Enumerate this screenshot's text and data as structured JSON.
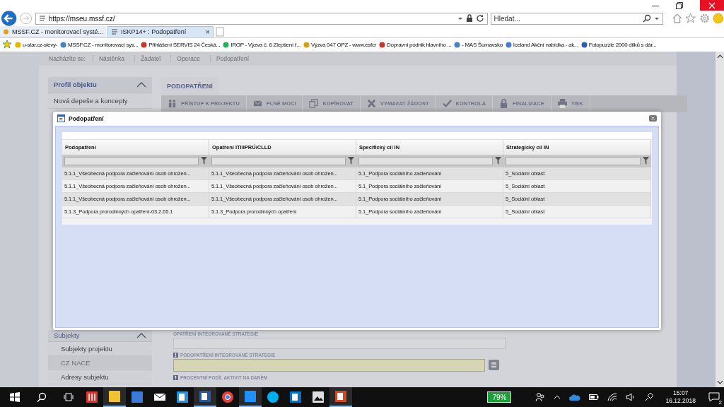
{
  "browser": {
    "url": "https://mseu.mssf.cz/",
    "search_placeholder": "Hledat...",
    "tabs": [
      {
        "label": "MSSF.CZ - monitorovací systé...",
        "selected": false
      },
      {
        "label": "ISKP14+ : Podopatření",
        "selected": true,
        "close": "×"
      }
    ],
    "favorites": [
      "u-star.cz-slevy-",
      "MSSF.CZ - monitorovací sys...",
      "Přihlášení SERVIS 24  Česká...",
      "IROP - Výzva č. 6 Zlepšení ř...",
      "Výzva 047 OPZ - www.esfcr",
      "Dopravní podnik hlavního ...",
      "- MAS Šumavsko",
      "Iceland  Akční nabídka - ak...",
      "Fotopuzzle 2000 dílků s dár..."
    ]
  },
  "breadcrumb": {
    "label": "Nacházíte se:",
    "items": [
      "Nástěnka",
      "Žadatel",
      "Operace",
      "Podopatření"
    ]
  },
  "sidebar": {
    "sections": [
      {
        "title": "Profil objektu",
        "expanded": true,
        "items": [
          {
            "label": "Nová depeše a koncepty",
            "disabled": false
          }
        ]
      },
      {
        "title": "Subjekty",
        "expanded": true,
        "items": [
          {
            "label": "Subjekty projektu",
            "disabled": false
          },
          {
            "label": "CZ NACE",
            "disabled": true
          },
          {
            "label": "Adresy subjektu",
            "disabled": false
          }
        ]
      }
    ]
  },
  "main": {
    "tab": "PODOPATŘENÍ",
    "toolbar": [
      "PŘÍSTUP K PROJEKTU",
      "PLNÉ MOCI",
      "KOPÍROVAT",
      "VYMAZAT ŽÁDOST",
      "KONTROLA",
      "FINALIZACE",
      "TISK"
    ],
    "fields": [
      {
        "label": "OPATŘENÍ INTEGROVANÉ STRATEGIE",
        "required": false,
        "kind": "text"
      },
      {
        "label": "PODOPATŘENÍ INTEGROVANÉ STRATEGIE",
        "required": true,
        "kind": "lookup"
      },
      {
        "label": "PROCENTNÍ PODÍL AKTIVIT NA DANÉM",
        "required": true,
        "kind": "label"
      }
    ]
  },
  "modal": {
    "title": "Podopatření",
    "columns": [
      "Podopatření",
      "Opatření ITI/IPRÚ/CLLD",
      "Specifický cíl IN",
      "Strategický cíl IN"
    ],
    "rows": [
      [
        "5.1.1_Všeobecná podpora začleňování osob ohrožen...",
        "5.1.1_Všeobecná podpora začleňování osob ohrožen...",
        "5.1_Podpora sociálního začleňování",
        "5_Sociální oblast"
      ],
      [
        "5.1.1_Všeobecná podpora začleňování osob ohrožen...",
        "5.1.1_Všeobecná podpora začleňování osob ohrožen...",
        "5.1_Podpora sociálního začleňování",
        "5_Sociální oblast"
      ],
      [
        "5.1.1_Všeobecná podpora začleňování osob ohrožen...",
        "5.1.1_Všeobecná podpora začleňování osob ohrožen...",
        "5.1_Podpora sociálního začleňování",
        "5_Sociální oblast"
      ],
      [
        "5.1.3_Podpora prorodinných opatření-03.2.65.1",
        "5.1.3_Podpora prorodinných opatření",
        "5.1_Podpora sociálního začleňování",
        "5_Sociální oblast"
      ]
    ]
  },
  "taskbar": {
    "battery": "79%",
    "time": "15:07",
    "date": "16.12.2018",
    "notifications": "2"
  }
}
